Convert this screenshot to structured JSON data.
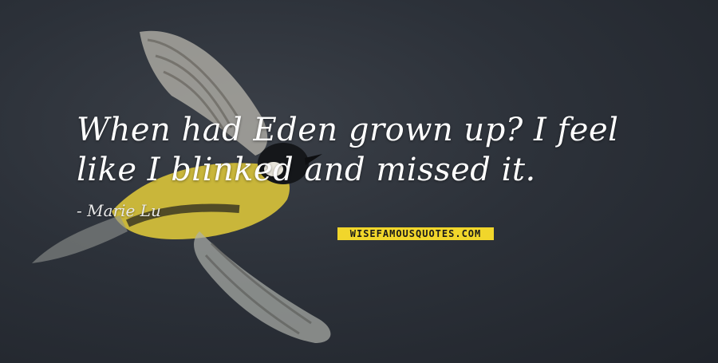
{
  "quote": {
    "text": "When had Eden grown up? I feel like I blinked and missed it.",
    "author": "- Marie Lu"
  },
  "watermark": {
    "text": "WISEFAMOUSQUOTES.COM",
    "color": "#f1d62b"
  },
  "colors": {
    "background": "#2a2f38",
    "bird_yellow": "#c9b63a",
    "text": "#ffffff"
  }
}
